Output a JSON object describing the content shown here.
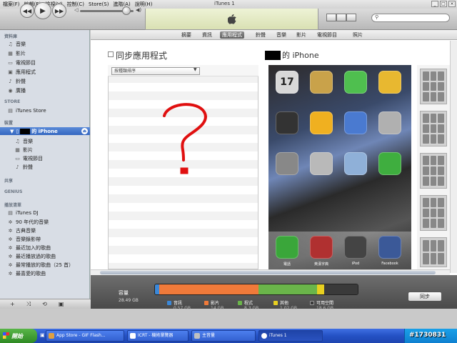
{
  "menubar": {
    "items": [
      "檔案(F)",
      "編輯(E)",
      "檢視(V)",
      "控制(C)",
      "Store(S)",
      "進階(A)",
      "說明(H)"
    ],
    "window_title": "iTunes 1"
  },
  "toolbar": {
    "prev_icon": "◀◀",
    "play_icon": "▶",
    "next_icon": "▶▶"
  },
  "tabs": [
    "摘要",
    "資訊",
    "應用程式",
    "鈴聲",
    "音樂",
    "影片",
    "電視節目",
    "照片"
  ],
  "active_tab": "應用程式",
  "sidebar": {
    "library_header": "資料庫",
    "library": [
      {
        "label": "音樂",
        "icon": "♫"
      },
      {
        "label": "影片",
        "icon": "▦"
      },
      {
        "label": "電視節目",
        "icon": "▭"
      },
      {
        "label": "應用程式",
        "icon": "▣"
      },
      {
        "label": "鈴聲",
        "icon": "♪"
      },
      {
        "label": "廣播",
        "icon": "◉"
      }
    ],
    "store_header": "STORE",
    "store": [
      {
        "label": "iTunes Store",
        "icon": "▤"
      }
    ],
    "devices_header": "裝置",
    "device_name": "的 iPhone",
    "device_items": [
      {
        "label": "音樂",
        "icon": "♫"
      },
      {
        "label": "影片",
        "icon": "▦"
      },
      {
        "label": "電視節目",
        "icon": "▭"
      },
      {
        "label": "鈴聲",
        "icon": "♪"
      }
    ],
    "shared_header": "共享",
    "genius_header": "GENIUS",
    "playlists_header": "播放清單",
    "playlists": [
      {
        "label": "iTunes DJ",
        "icon": "▤"
      },
      {
        "label": "90 年代的音樂",
        "icon": "✲"
      },
      {
        "label": "古典音樂",
        "icon": "✲"
      },
      {
        "label": "音樂錄影帶",
        "icon": "✲"
      },
      {
        "label": "最近加入的歌曲",
        "icon": "✲"
      },
      {
        "label": "最近播放過的歌曲",
        "icon": "✲"
      },
      {
        "label": "最常播放的歌曲（25 首）",
        "icon": "✲"
      },
      {
        "label": "最喜愛的歌曲",
        "icon": "✲"
      }
    ],
    "bottom_controls": [
      "+",
      "⤨",
      "⟲",
      "▣"
    ]
  },
  "apps_panel": {
    "title": "同步應用程式",
    "sort_placeholder": "按種類排序",
    "iphone_title": "的 iPhone"
  },
  "phone": {
    "icons": [
      {
        "name": "calendar",
        "color": "#d8d8d8",
        "text": "17"
      },
      {
        "name": "photos",
        "color": "#c9a24a",
        "text": ""
      },
      {
        "name": "messages",
        "color": "#4fbf4f",
        "text": ""
      },
      {
        "name": "sunflower",
        "color": "#e8b830",
        "text": ""
      },
      {
        "name": "camera",
        "color": "#333333",
        "text": ""
      },
      {
        "name": "weather",
        "color": "#f0b020",
        "text": ""
      },
      {
        "name": "mail",
        "color": "#4a7ad0",
        "text": ""
      },
      {
        "name": "notes",
        "color": "#b0b0b0",
        "text": ""
      },
      {
        "name": "settings",
        "color": "#888888",
        "text": ""
      },
      {
        "name": "app-a",
        "color": "#b9b9b9",
        "text": ""
      },
      {
        "name": "app-b",
        "color": "#8fb0d8",
        "text": ""
      },
      {
        "name": "whatsapp",
        "color": "#3fae3f",
        "text": ""
      }
    ],
    "dock": [
      {
        "name": "phone",
        "color": "#3aa63a",
        "label": "電話"
      },
      {
        "name": "dictionary",
        "color": "#b03030",
        "label": "英漢字典"
      },
      {
        "name": "ipod",
        "color": "#444444",
        "label": "iPod"
      },
      {
        "name": "facebook",
        "color": "#3b5998",
        "label": "Facebook"
      }
    ]
  },
  "capacity": {
    "label": "容量",
    "total": "28.49 GB",
    "sync_label": "同步",
    "segments": [
      {
        "name": "音訊",
        "size": "0.57 GB",
        "color": "#3b88d8",
        "fraction": 0.02
      },
      {
        "name": "影片",
        "size": "14 GB",
        "color": "#f07a3a",
        "fraction": 0.49
      },
      {
        "name": "程式",
        "size": "8.3 GB",
        "color": "#6ab54a",
        "fraction": 0.29
      },
      {
        "name": "其他",
        "size": "1.02 GB",
        "color": "#e8d020",
        "fraction": 0.035
      },
      {
        "name": "可用空間",
        "size": "18.6 GB",
        "color": "#3a3a3a",
        "fraction": 0.165
      }
    ]
  },
  "taskbar": {
    "start_label": "開始",
    "tasks": [
      {
        "label": "App Store - GIF Flash...",
        "color": "#e0a040"
      },
      {
        "label": "ICRT - 機術瀏覽器",
        "color": "#ffffff"
      },
      {
        "label": "主音量",
        "color": "#c0c0c0"
      },
      {
        "label": "iTunes 1",
        "color": "#ffffff"
      }
    ],
    "watermark": "#1730831"
  }
}
